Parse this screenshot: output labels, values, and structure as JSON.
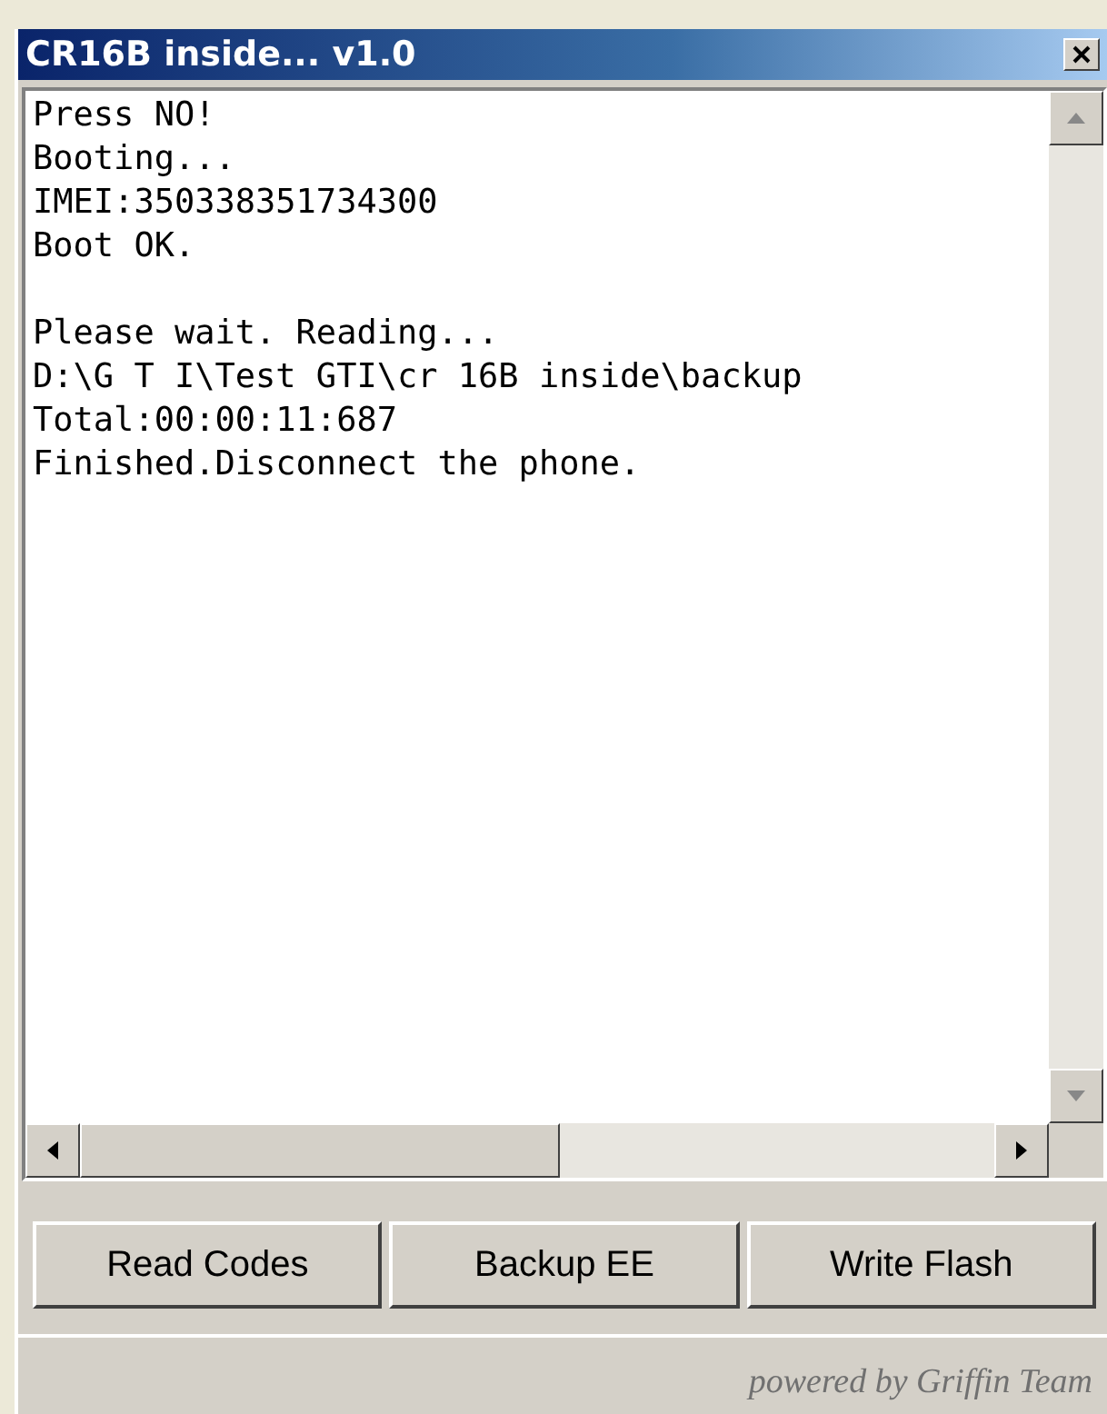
{
  "window": {
    "title": "CR16B inside... v1.0"
  },
  "log": {
    "blocks": [
      [
        "Press NO!",
        "Booting...",
        "IMEI:350338351734300",
        "Boot OK."
      ],
      [
        "Please wait. Reading...",
        "D:\\G T I\\Test GTI\\cr 16B inside\\backup",
        "Total:00:00:11:687",
        "Finished.Disconnect the phone."
      ]
    ]
  },
  "buttons": [
    "Read Codes",
    "Backup EE",
    "Write Flash"
  ],
  "status_bar": {
    "text": "powered by Griffin Team"
  }
}
